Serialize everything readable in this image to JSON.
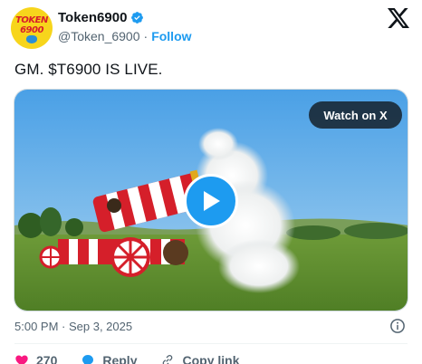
{
  "account": {
    "display_name": "Token6900",
    "handle": "@Token_6900",
    "separator": "·",
    "follow_label": "Follow",
    "avatar_text_top": "TOKEN",
    "avatar_text_bottom": "6900",
    "verified_icon": "verified-badge-icon"
  },
  "brand_icon": "x-logo-icon",
  "tweet": {
    "text": "GM. $T6900 IS LIVE."
  },
  "media": {
    "watch_label": "Watch on X",
    "play_icon": "play-icon"
  },
  "meta": {
    "timestamp": "5:00 PM · Sep 3, 2025",
    "info_icon": "info-icon"
  },
  "actions": {
    "like_count": "270",
    "reply_label": "Reply",
    "copy_link_label": "Copy link"
  },
  "colors": {
    "accent": "#1d9bf0",
    "like": "#f91880",
    "text_primary": "#0f1419",
    "text_secondary": "#536471"
  }
}
